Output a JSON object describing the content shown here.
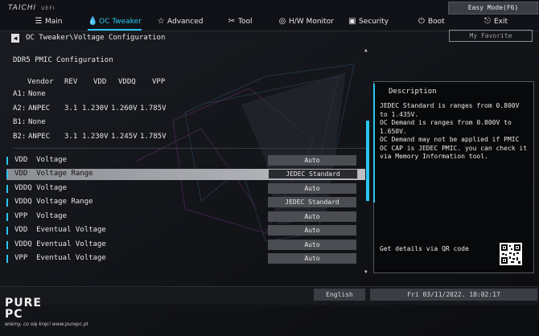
{
  "header": {
    "logo": "TAICHI",
    "logo_sub": "UEFI",
    "easy_mode": "Easy Mode(F6)",
    "tabs": [
      {
        "label": "Main",
        "icon": "list-icon"
      },
      {
        "label": "OC Tweaker",
        "icon": "flame-icon"
      },
      {
        "label": "Advanced",
        "icon": "star-icon"
      },
      {
        "label": "Tool",
        "icon": "tools-icon"
      },
      {
        "label": "H/W Monitor",
        "icon": "monitor-icon"
      },
      {
        "label": "Security",
        "icon": "shield-icon"
      },
      {
        "label": "Boot",
        "icon": "power-icon"
      },
      {
        "label": "Exit",
        "icon": "exit-icon"
      }
    ],
    "active_tab": "OC Tweaker"
  },
  "breadcrumb": "OC Tweaker\\Voltage Configuration",
  "my_favorite": "My Favorite",
  "pmic": {
    "section_title": "DDR5 PMIC Configuration",
    "columns": [
      "Vendor",
      "REV",
      "VDD",
      "VDDQ",
      "VPP"
    ],
    "rows": [
      {
        "slot": "A1:",
        "vendor": "None",
        "rev": "",
        "vdd": "",
        "vddq": "",
        "vpp": ""
      },
      {
        "slot": "A2:",
        "vendor": "ANPEC",
        "rev": "3.1",
        "vdd": "1.230V",
        "vddq": "1.260V",
        "vpp": "1.785V"
      },
      {
        "slot": "B1:",
        "vendor": "None",
        "rev": "",
        "vdd": "",
        "vddq": "",
        "vpp": ""
      },
      {
        "slot": "B2:",
        "vendor": "ANPEC",
        "rev": "3.1",
        "vdd": "1.230V",
        "vddq": "1.245V",
        "vpp": "1.785V"
      }
    ]
  },
  "settings": [
    {
      "label": "VDD  Voltage",
      "value": "Auto"
    },
    {
      "label": "VDD  Voltage Range",
      "value": "JEDEC Standard",
      "selected": true
    },
    {
      "label": "VDDQ Voltage",
      "value": "Auto"
    },
    {
      "label": "VDDQ Voltage Range",
      "value": "JEDEC Standard"
    },
    {
      "label": "VPP  Voltage",
      "value": "Auto"
    },
    {
      "label": "VDD  Eventual Voltage",
      "value": "Auto"
    },
    {
      "label": "VDDQ Eventual Voltage",
      "value": "Auto"
    },
    {
      "label": "VPP  Eventual Voltage",
      "value": "Auto"
    }
  ],
  "description": {
    "title": "Description",
    "paragraphs": [
      "JEDEC Standard is ranges from 0.800V to 1.435V.",
      "OC Demand is ranges from 0.800V to 1.650V.",
      "OC Demand may not be applied if PMIC OC CAP is JEDEC PMIC. you can check it via Memory Information tool."
    ],
    "qr_label": "Get details via QR code"
  },
  "footer": {
    "language": "English",
    "datetime": "Fri 03/11/2022. 18:02:17"
  },
  "watermark": {
    "line1": "PURE",
    "line2": "PC",
    "tagline": "wiemy, co się kręci  www.purepc.pl"
  },
  "colors": {
    "accent": "#29c6f0",
    "background": "#0c0d10",
    "selected_row": "#a8aaaf"
  }
}
